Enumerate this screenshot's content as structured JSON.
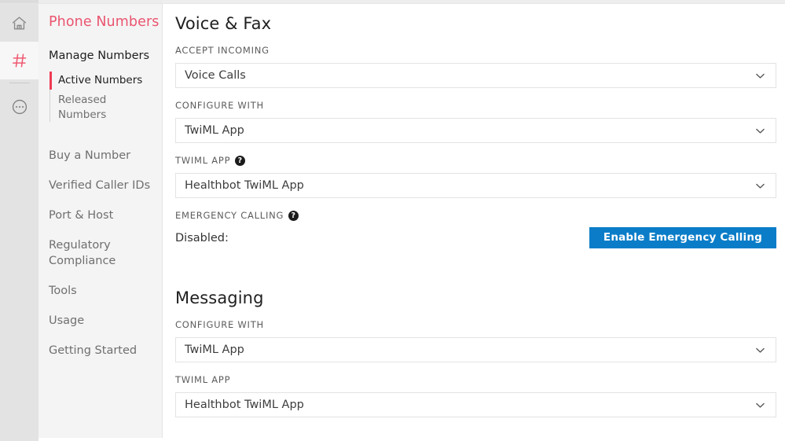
{
  "colors": {
    "brand_red": "#ea5570",
    "accent_red": "#ef3a52",
    "primary_blue": "#0b7dc8",
    "rail_bg": "#e3e3e3",
    "sidebar_bg": "#f4f4f4"
  },
  "rail": {
    "items": [
      {
        "icon": "home-icon",
        "name": "rail-item-home",
        "active": false
      },
      {
        "icon": "hash-icon",
        "name": "rail-item-phone-numbers",
        "active": true
      },
      {
        "icon": "more-circle-icon",
        "name": "rail-item-more",
        "active": false
      }
    ]
  },
  "sidebar": {
    "title": "Phone Numbers",
    "section_heading": "Manage Numbers",
    "sub_items": [
      {
        "label": "Active Numbers",
        "active": true
      },
      {
        "label": "Released Numbers",
        "active": false
      }
    ],
    "items": [
      {
        "label": "Buy a Number"
      },
      {
        "label": "Verified Caller IDs"
      },
      {
        "label": "Port & Host"
      },
      {
        "label": "Regulatory Compliance"
      },
      {
        "label": "Tools"
      },
      {
        "label": "Usage"
      },
      {
        "label": "Getting Started"
      }
    ]
  },
  "main": {
    "voice_fax": {
      "title": "Voice & Fax",
      "accept_incoming": {
        "label": "ACCEPT INCOMING",
        "value": "Voice Calls",
        "has_help": false
      },
      "configure_with": {
        "label": "CONFIGURE WITH",
        "value": "TwiML App",
        "has_help": false
      },
      "twiml_app": {
        "label": "TWIML APP",
        "value": "Healthbot TwiML App",
        "has_help": true,
        "help_glyph": "?"
      },
      "emergency_calling": {
        "label": "EMERGENCY CALLING",
        "has_help": true,
        "help_glyph": "?",
        "status": "Disabled:",
        "button_label": "Enable Emergency Calling"
      }
    },
    "messaging": {
      "title": "Messaging",
      "configure_with": {
        "label": "CONFIGURE WITH",
        "value": "TwiML App",
        "has_help": false
      },
      "twiml_app": {
        "label": "TWIML APP",
        "value": "Healthbot TwiML App",
        "has_help": false
      }
    }
  }
}
